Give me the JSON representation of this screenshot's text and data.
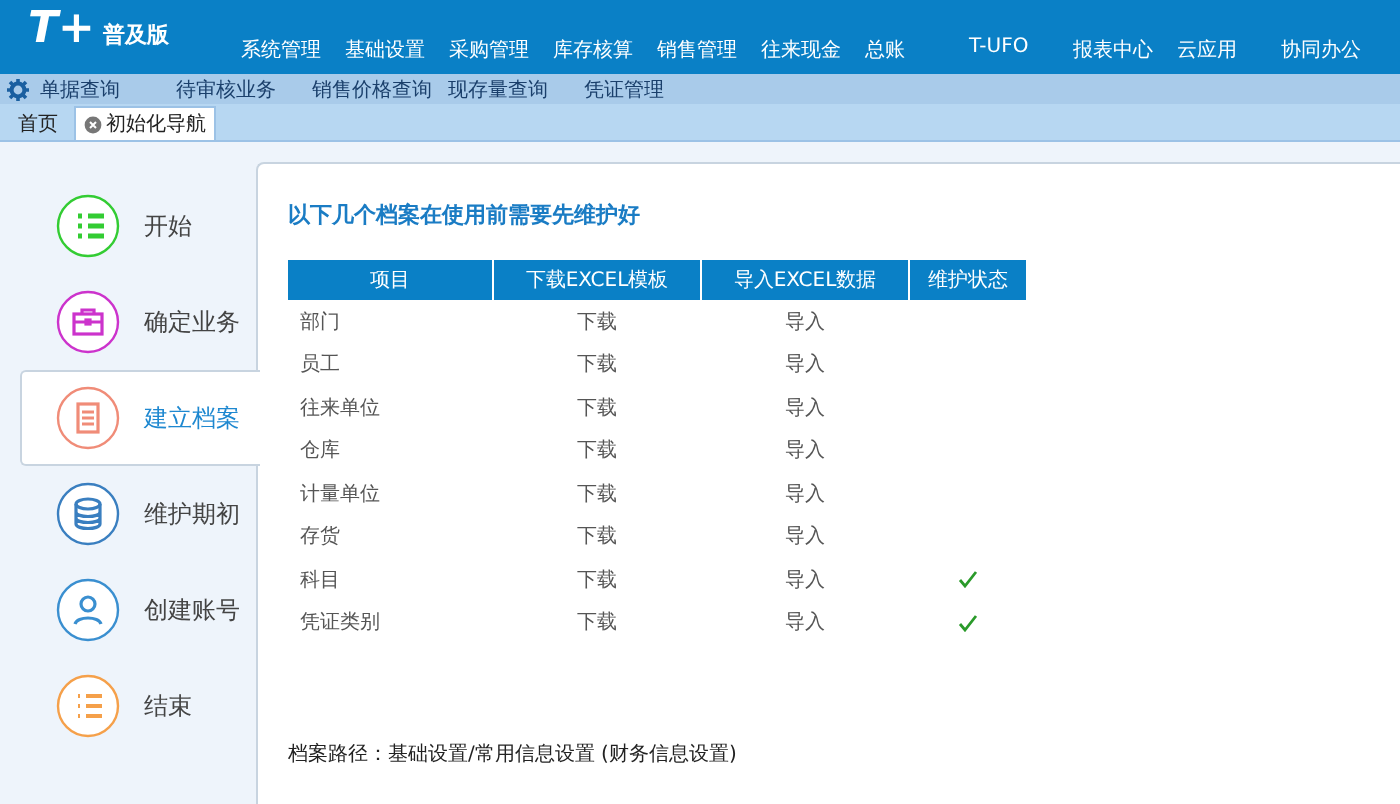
{
  "header": {
    "logo": "T+",
    "edition": "普及版",
    "menu": [
      "系统管理",
      "基础设置",
      "采购管理",
      "库存核算",
      "销售管理",
      "往来现金",
      "总账",
      "T-UFO",
      "报表中心",
      "云应用",
      "协同办公"
    ]
  },
  "toolbar": {
    "items": [
      "单据查询",
      "待审核业务",
      "销售价格查询",
      "现存量查询",
      "凭证管理"
    ]
  },
  "tabs": [
    {
      "label": "首页",
      "selected": false,
      "closable": false
    },
    {
      "label": "初始化导航",
      "selected": true,
      "closable": true
    }
  ],
  "steps": [
    {
      "label": "开始",
      "color": "#33cc33",
      "selected": false
    },
    {
      "label": "确定业务",
      "color": "#cc33cc",
      "selected": false
    },
    {
      "label": "建立档案",
      "color": "#f08c78",
      "selected": true
    },
    {
      "label": "维护期初",
      "color": "#3a7fc0",
      "selected": false
    },
    {
      "label": "创建账号",
      "color": "#3a8fd0",
      "selected": false
    },
    {
      "label": "结束",
      "color": "#f5a04a",
      "selected": false
    }
  ],
  "panel": {
    "heading": "以下几个档案在使用前需要先维护好",
    "table": {
      "columns": [
        "项目",
        "下载EXCEL模板",
        "导入EXCEL数据",
        "维护状态"
      ],
      "rows": [
        {
          "item": "部门",
          "download": "下载",
          "import": "导入",
          "maintained": false
        },
        {
          "item": "员工",
          "download": "下载",
          "import": "导入",
          "maintained": false
        },
        {
          "item": "往来单位",
          "download": "下载",
          "import": "导入",
          "maintained": false
        },
        {
          "item": "仓库",
          "download": "下载",
          "import": "导入",
          "maintained": false
        },
        {
          "item": "计量单位",
          "download": "下载",
          "import": "导入",
          "maintained": false
        },
        {
          "item": "存货",
          "download": "下载",
          "import": "导入",
          "maintained": false
        },
        {
          "item": "科目",
          "download": "下载",
          "import": "导入",
          "maintained": true
        },
        {
          "item": "凭证类别",
          "download": "下载",
          "import": "导入",
          "maintained": true
        }
      ]
    },
    "path_note": "档案路径：基础设置/常用信息设置 (财务信息设置)"
  }
}
